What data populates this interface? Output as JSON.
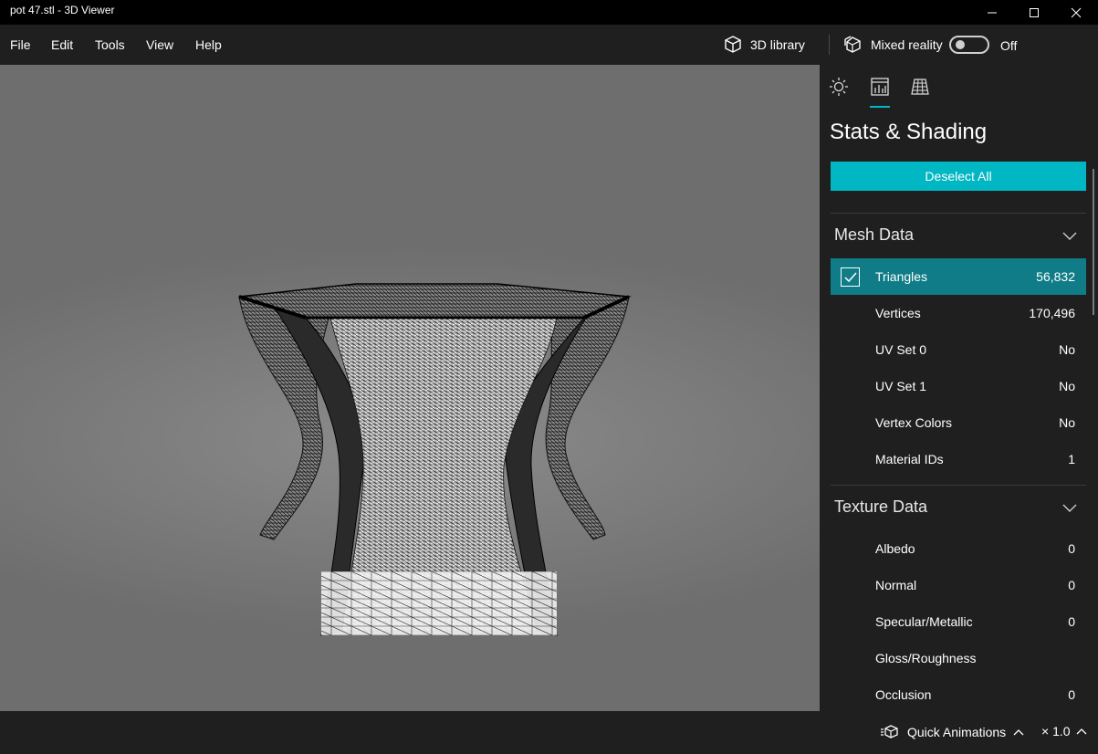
{
  "window": {
    "title": "pot 47.stl - 3D Viewer"
  },
  "menu": {
    "items": [
      "File",
      "Edit",
      "Tools",
      "View",
      "Help"
    ],
    "library_label": "3D library",
    "mixed_reality_label": "Mixed reality",
    "mixed_reality_state": "Off"
  },
  "panel": {
    "tabs": [
      {
        "icon": "sun-icon",
        "active": false
      },
      {
        "icon": "stats-icon",
        "active": true
      },
      {
        "icon": "grid-icon",
        "active": false
      }
    ],
    "title": "Stats & Shading",
    "deselect_label": "Deselect All",
    "mesh_section": {
      "title": "Mesh Data",
      "rows": [
        {
          "label": "Triangles",
          "value": "56,832",
          "selected": true
        },
        {
          "label": "Vertices",
          "value": "170,496"
        },
        {
          "label": "UV Set 0",
          "value": "No"
        },
        {
          "label": "UV Set 1",
          "value": "No"
        },
        {
          "label": "Vertex Colors",
          "value": "No"
        },
        {
          "label": "Material IDs",
          "value": "1"
        }
      ]
    },
    "texture_section": {
      "title": "Texture Data",
      "rows": [
        {
          "label": "Albedo",
          "value": "0"
        },
        {
          "label": "Normal",
          "value": "0"
        },
        {
          "label": "Specular/Metallic",
          "value": "0"
        },
        {
          "label": "Gloss/Roughness",
          "value": ""
        },
        {
          "label": "Occlusion",
          "value": "0"
        }
      ]
    }
  },
  "bottom": {
    "quick_animations_label": "Quick Animations",
    "speed_label": "× 1.0"
  },
  "colors": {
    "accent": "#00b7c3",
    "selected_row": "#0f7c87",
    "background": "#1f1f1f",
    "viewport": "#7e7e7e"
  }
}
